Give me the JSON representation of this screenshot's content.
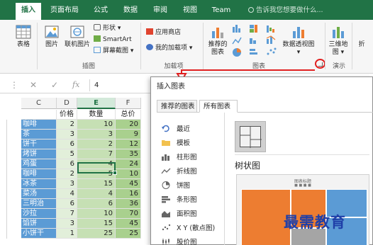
{
  "ribbon_tabs": {
    "insert": "插入",
    "page_layout": "页面布局",
    "formulas": "公式",
    "data": "数据",
    "review": "审阅",
    "view": "视图",
    "team": "Team"
  },
  "tell_me": {
    "placeholder": "告诉我您想要做什么..."
  },
  "ribbon": {
    "table": "表格",
    "pictures": "图片",
    "online_pictures": "联机图片",
    "shapes": "形状",
    "smartart": "SmartArt",
    "screenshot": "屏幕截图",
    "illustrations_group": "插图",
    "store": "应用商店",
    "my_addins": "我的加载项",
    "addins_group": "加载项",
    "recommended_charts_line1": "推荐的",
    "recommended_charts_line2": "图表",
    "pivot_chart": "数据透视图",
    "charts_group": "图表",
    "map3d_line1": "三维地",
    "map3d_line2": "图",
    "tours_group": "演示",
    "sparkline_partial": "折"
  },
  "formula_bar": {
    "value": "4",
    "fx": "fx"
  },
  "sheet": {
    "columns": [
      "C",
      "D",
      "E",
      "F"
    ],
    "selected_column": "E",
    "headers": {
      "name": "",
      "price": "价格",
      "qty": "数量",
      "total": "总价"
    },
    "rows": [
      {
        "name": "咖啡",
        "price": "2",
        "qty": "10",
        "total": "20"
      },
      {
        "name": "茶",
        "price": "3",
        "qty": "3",
        "total": "9"
      },
      {
        "name": "饼干",
        "price": "6",
        "qty": "2",
        "total": "12"
      },
      {
        "name": "烤饼",
        "price": "5",
        "qty": "7",
        "total": "35"
      },
      {
        "name": "鸡蛋",
        "price": "6",
        "qty": "4",
        "total": "24"
      },
      {
        "name": "咖啡",
        "price": "2",
        "qty": "5",
        "total": "10"
      },
      {
        "name": "冰茶",
        "price": "3",
        "qty": "15",
        "total": "45"
      },
      {
        "name": "菜汤",
        "price": "4",
        "qty": "4",
        "total": "16"
      },
      {
        "name": "三明治",
        "price": "6",
        "qty": "6",
        "total": "36"
      },
      {
        "name": "沙拉",
        "price": "7",
        "qty": "10",
        "total": "70"
      },
      {
        "name": "馅饼",
        "price": "3",
        "qty": "15",
        "total": "45"
      },
      {
        "name": "小饼干",
        "price": "1",
        "qty": "25",
        "total": "25"
      }
    ]
  },
  "dialog": {
    "title": "插入图表",
    "tabs": {
      "recommended": "推荐的图表",
      "all": "所有图表"
    },
    "chart_types": [
      {
        "label": "最近",
        "icon": "recent-icon"
      },
      {
        "label": "模板",
        "icon": "folder-icon"
      },
      {
        "label": "柱形图",
        "icon": "column-chart-icon"
      },
      {
        "label": "折线图",
        "icon": "line-chart-icon"
      },
      {
        "label": "饼图",
        "icon": "pie-chart-icon"
      },
      {
        "label": "条形图",
        "icon": "bar-chart-icon"
      },
      {
        "label": "面积图",
        "icon": "area-chart-icon"
      },
      {
        "label": "X Y (散点图)",
        "icon": "scatter-chart-icon"
      },
      {
        "label": "股价图",
        "icon": "stock-chart-icon"
      }
    ],
    "preview_title": "树状图",
    "preview_chart_title": "图表标题"
  },
  "watermark": "最需教育",
  "colors": {
    "ribbon_green": "#217346",
    "name_blue": "#5b9bd5",
    "treemap_orange": "#ed7d31",
    "treemap_blue": "#5b9bd5",
    "annotation_red": "#e02020",
    "watermark_blue": "#1f3fa8"
  }
}
